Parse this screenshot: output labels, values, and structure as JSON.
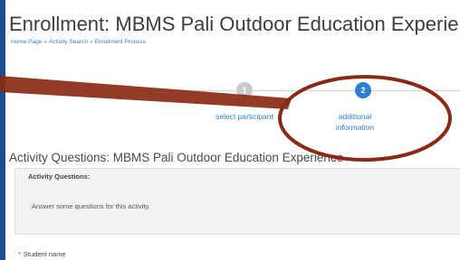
{
  "page": {
    "title": "Enrollment: MBMS Pali Outdoor Education Experience",
    "breadcrumb": [
      "Home Page",
      "Activity Search",
      "Enrollment Process"
    ],
    "breadcrumb_separator": "»"
  },
  "stepper": {
    "steps": [
      {
        "number": "1",
        "label": "select participant",
        "state": "completed"
      },
      {
        "number": "2",
        "label": "additional information",
        "state": "active"
      }
    ],
    "active_color": "#2f7fd0"
  },
  "section": {
    "title": "Activity Questions: MBMS Pali Outdoor Education Experience",
    "panel_heading": "Activity Questions:",
    "panel_description": "Answer some questions for this activity."
  },
  "form": {
    "required_marker": "*",
    "student_name_label": "Student name"
  },
  "annotation": {
    "color": "#8a2a14"
  }
}
